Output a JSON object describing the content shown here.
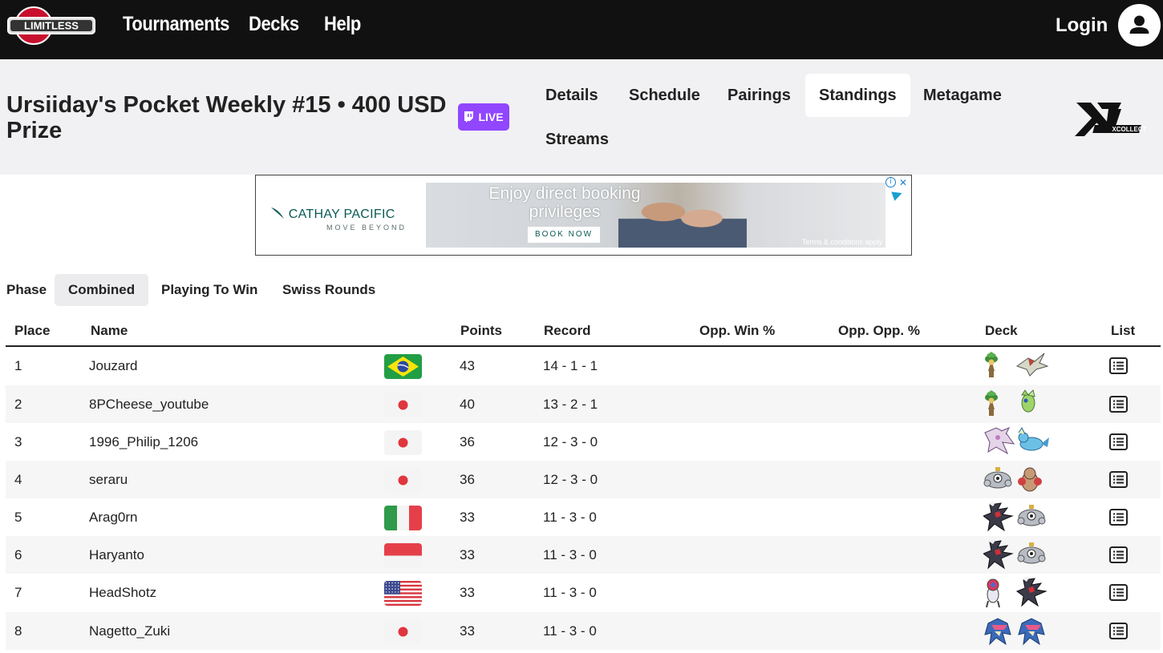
{
  "nav": {
    "logo_text": "LIMITLESS",
    "links": [
      "Tournaments",
      "Decks",
      "Help"
    ],
    "login": "Login"
  },
  "tournament": {
    "title": "Ursiiday's Pocket Weekly #15 • 400 USD Prize",
    "live_label": "LIVE",
    "tabs": [
      "Details",
      "Schedule",
      "Pairings",
      "Standings",
      "Metagame",
      "Streams"
    ],
    "active_tab": "Standings",
    "sponsor_logo_text": "XCOLLECT"
  },
  "ad": {
    "brand": "CATHAY PACIFIC",
    "tagline": "MOVE BEYOND",
    "headline": "Enjoy direct booking privileges",
    "cta": "BOOK NOW",
    "terms": "Terms & conditions apply"
  },
  "phase": {
    "label": "Phase",
    "options": [
      "Combined",
      "Playing To Win",
      "Swiss Rounds"
    ],
    "selected": "Combined"
  },
  "table": {
    "headers": [
      "Place",
      "Name",
      "Points",
      "Record",
      "Opp. Win %",
      "Opp. Opp. %",
      "Deck",
      "List"
    ],
    "rows": [
      {
        "place": "1",
        "name": "Jouzard",
        "flag": "brazil",
        "points": "43",
        "record": "14 - 1 - 1",
        "deck": [
          "exeggutor-icon",
          "kartana-icon"
        ]
      },
      {
        "place": "2",
        "name": "8PCheese_youtube",
        "flag": "japan",
        "points": "40",
        "record": "13 - 2 - 1",
        "deck": [
          "exeggutor-icon",
          "celebi-icon"
        ]
      },
      {
        "place": "3",
        "name": "1996_Philip_1206",
        "flag": "japan",
        "points": "36",
        "record": "12 - 3 - 0",
        "deck": [
          "palkia-icon",
          "vaporeon-icon"
        ]
      },
      {
        "place": "4",
        "name": "seraru",
        "flag": "japan",
        "points": "36",
        "record": "12 - 3 - 0",
        "deck": [
          "magnezone-icon",
          "hitmonchan-icon"
        ]
      },
      {
        "place": "5",
        "name": "Arag0rn",
        "flag": "italy",
        "points": "33",
        "record": "11 - 3 - 0",
        "deck": [
          "darkrai-icon",
          "magnezone-icon"
        ]
      },
      {
        "place": "6",
        "name": "Haryanto",
        "flag": "indonesia",
        "points": "33",
        "record": "11 - 3 - 0",
        "deck": [
          "darkrai-icon",
          "magnezone-icon"
        ]
      },
      {
        "place": "7",
        "name": "HeadShotz",
        "flag": "usa",
        "points": "33",
        "record": "11 - 3 - 0",
        "deck": [
          "pheromosa-icon",
          "darkrai-icon"
        ]
      },
      {
        "place": "8",
        "name": "Nagetto_Zuki",
        "flag": "japan",
        "points": "33",
        "record": "11 - 3 - 0",
        "deck": [
          "greninja-icon",
          "greninja-icon"
        ]
      }
    ]
  },
  "colors": {
    "nav_bg": "#111111",
    "header_bg": "#f1f1f3",
    "live_bg": "#9146ff",
    "row_alt": "#f6f6f7"
  }
}
